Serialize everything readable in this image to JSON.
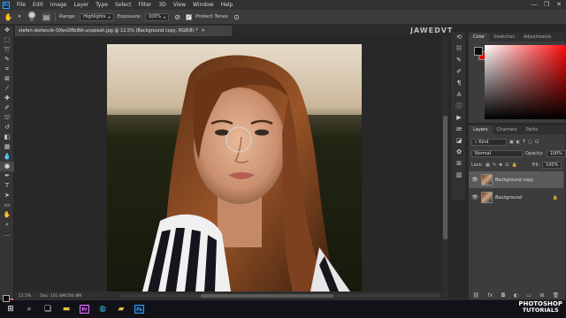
{
  "menubar": {
    "logo": "Ps",
    "items": [
      "File",
      "Edit",
      "Image",
      "Layer",
      "Type",
      "Select",
      "Filter",
      "3D",
      "View",
      "Window",
      "Help"
    ],
    "controls": [
      "—",
      "❐",
      "✕"
    ]
  },
  "options": {
    "brush_size": "65",
    "range_label": "Range:",
    "range_value": "Highlights",
    "exposure_label": "Exposure:",
    "exposure_value": "100%",
    "protect_tones_label": "Protect Tones"
  },
  "document": {
    "tab_title": "stefan-stefancik-QXevDflbl8A-unsplash.jpg @ 12.5% (Background copy, RGB/8) *",
    "zoom": "12.5%",
    "doc_info": "Doc: 101.4M/204.8M"
  },
  "watermark": "JAWEDVT",
  "color_panel": {
    "tabs": [
      "Color",
      "Swatches",
      "Adjustments"
    ],
    "foreground": "#0b0b0b",
    "background": "#e00000"
  },
  "layers_panel": {
    "tabs": [
      "Layers",
      "Channels",
      "Paths"
    ],
    "filter_kind": "Kind",
    "blend_mode": "Normal",
    "opacity_label": "Opacity:",
    "opacity_value": "100%",
    "lock_label": "Lock:",
    "fill_label": "Fill:",
    "fill_value": "100%",
    "layers": [
      {
        "name": "Background copy",
        "selected": true
      },
      {
        "name": "Background",
        "selected": false
      }
    ]
  },
  "taskbar": {
    "brand_line1": "PHOTOSHOP",
    "brand_line2": "TUTORIALS"
  }
}
